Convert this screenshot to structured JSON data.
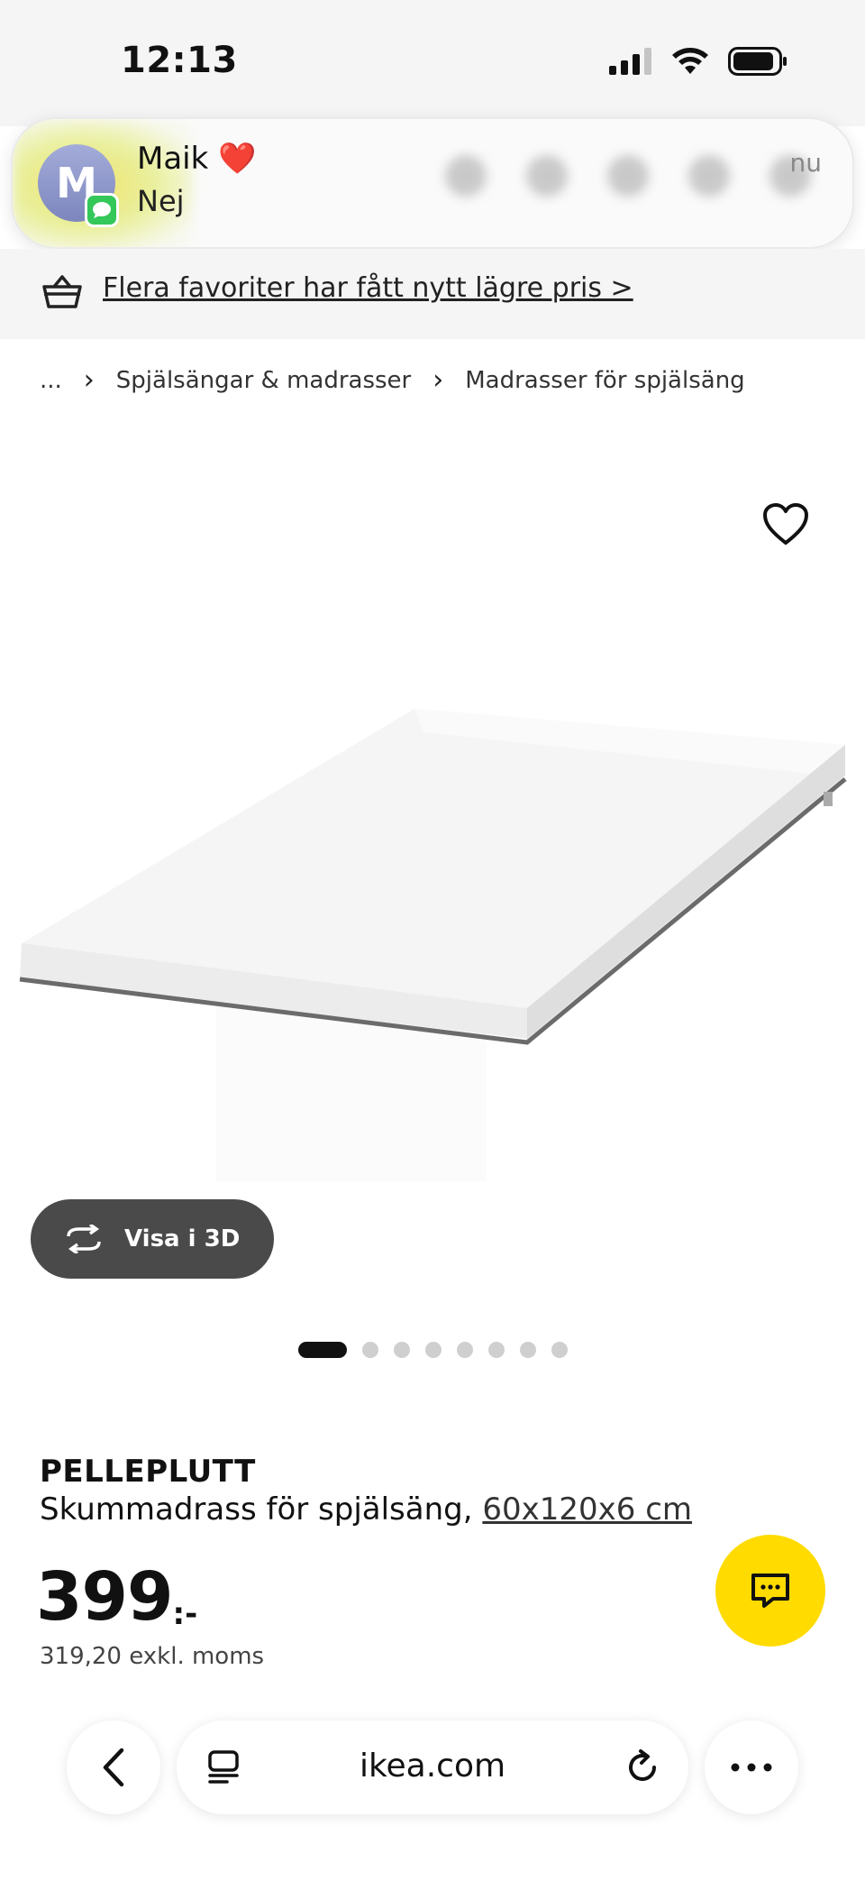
{
  "status_bar": {
    "time": "12:13",
    "icons": [
      "cellular-signal-icon",
      "wifi-icon",
      "battery-icon"
    ]
  },
  "notification": {
    "avatar_initial": "M",
    "sender": "Maik ❤️",
    "message": "Nej",
    "time": "nu",
    "app_icon": "messages-icon"
  },
  "promo": {
    "icon": "shopping-basket-icon",
    "text": "Flera favoriter har fått nytt lägre pris >"
  },
  "breadcrumb": {
    "items": [
      "...",
      "Spjälsängar & madrasser",
      "Madrasser för spjälsäng"
    ],
    "separator": "›"
  },
  "product": {
    "image_icon": "mattress-image",
    "favorite_icon": "heart-icon",
    "view_3d_label": "Visa i 3D",
    "view_3d_icon": "rotate-3d-icon",
    "carousel": {
      "total": 8,
      "active": 1
    },
    "name": "PELLEPLUTT",
    "description": "Skummadrass för spjälsäng, ",
    "size": "60x120x6 cm",
    "price": "399",
    "price_suffix": ":-",
    "price_excl_vat": "319,20 exkl. moms"
  },
  "chat": {
    "icon": "chat-bubble-icon",
    "color": "#ffdb00"
  },
  "browser": {
    "url": "ikea.com",
    "back_icon": "chevron-left-icon",
    "tabs_icon": "reader-icon",
    "reload_icon": "reload-icon",
    "more_icon": "more-horizontal-icon"
  }
}
